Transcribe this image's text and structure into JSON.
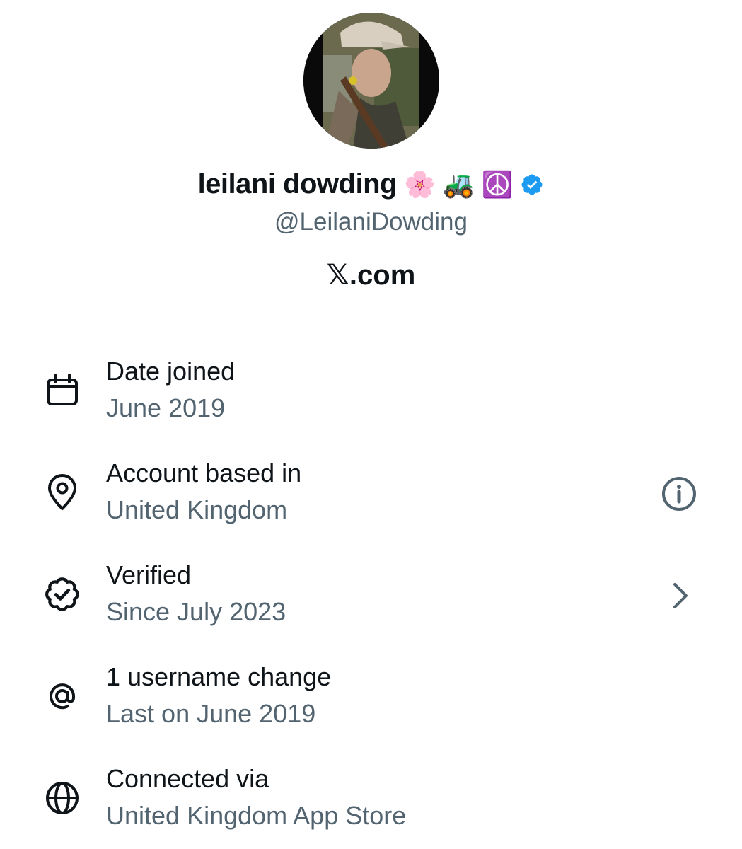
{
  "profile": {
    "display_name": "leilani dowding",
    "name_emojis": [
      "🌸",
      "🚜",
      "☮️"
    ],
    "handle": "@LeilaniDowding",
    "site": "𝕏.com"
  },
  "colors": {
    "primary_text": "#0f1419",
    "secondary_text": "#536471",
    "verified_blue": "#1d9bf0"
  },
  "details": [
    {
      "icon": "calendar-icon",
      "title": "Date joined",
      "value": "June 2019"
    },
    {
      "icon": "location-pin-icon",
      "title": "Account based in",
      "value": "United Kingdom",
      "trailing_icon": "info-icon"
    },
    {
      "icon": "verified-badge-icon",
      "title": "Verified",
      "value": "Since July 2023",
      "trailing_icon": "chevron-right-icon"
    },
    {
      "icon": "at-sign-icon",
      "title": "1 username change",
      "value": "Last on June 2019"
    },
    {
      "icon": "globe-icon",
      "title": "Connected via",
      "value": "United Kingdom App Store"
    }
  ]
}
